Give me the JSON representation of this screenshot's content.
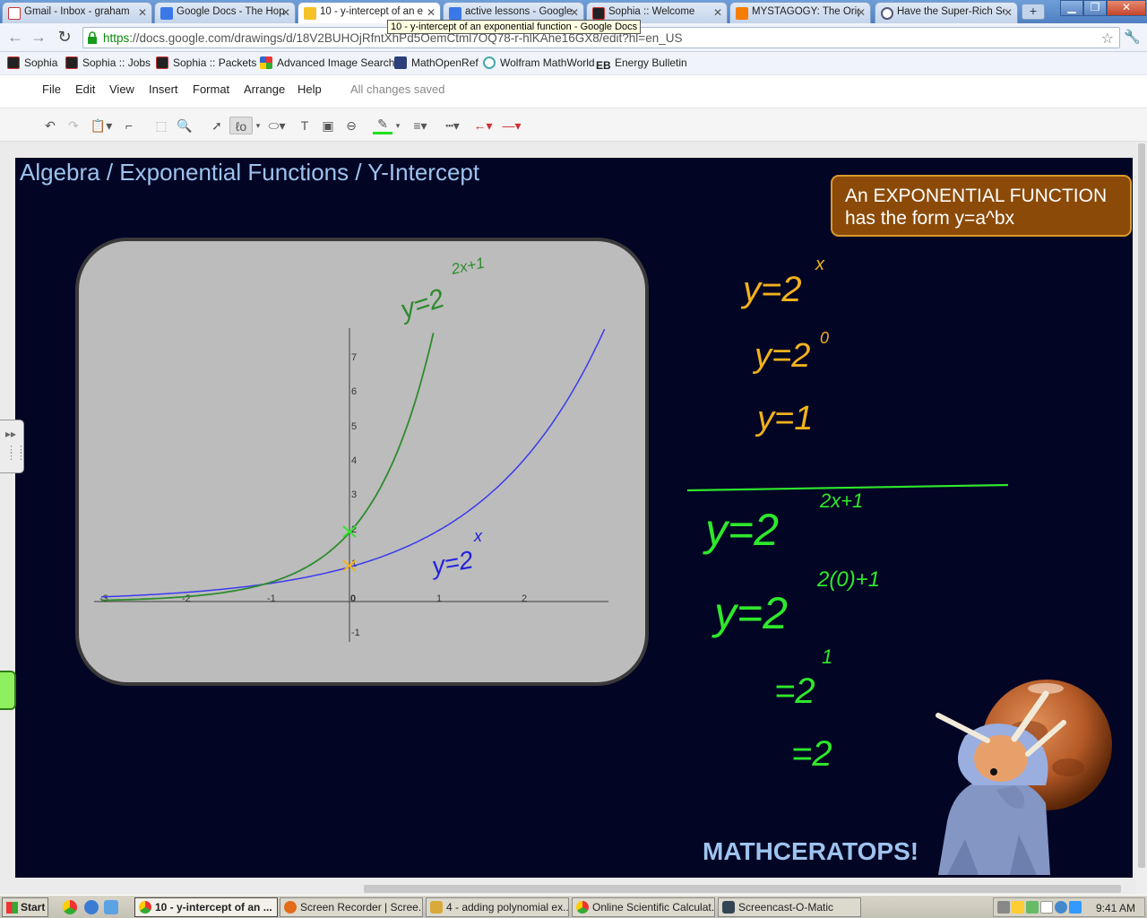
{
  "browser": {
    "tabs": [
      {
        "label": "Gmail - Inbox - graham",
        "icon": "gmail-icon"
      },
      {
        "label": "Google Docs - The Hopp",
        "icon": "google-docs-icon"
      },
      {
        "label": "10 - y-intercept of an e",
        "icon": "google-drawings-icon",
        "active": true
      },
      {
        "label": "active lessons - Google",
        "icon": "google-docs-icon"
      },
      {
        "label": "Sophia :: Welcome",
        "icon": "sophia-icon"
      },
      {
        "label": "MYSTAGOGY: The Origi",
        "icon": "blogger-icon"
      },
      {
        "label": "Have the Super-Rich Se",
        "icon": "globe-icon"
      }
    ],
    "tooltip": "10 - y-intercept of an exponential function - Google Docs",
    "url_scheme": "https",
    "url_rest": "://docs.google.com/drawings/d/18V2BUHOjRfntXhPd5OemCtml7OQ78-r-hlKAhe16GX8/edit?hl=en_US",
    "bookmarks": [
      "Sophia",
      "Sophia :: Jobs",
      "Sophia :: Packets",
      "Advanced Image Search",
      "MathOpenRef",
      "Wolfram MathWorld",
      "Energy Bulletin"
    ]
  },
  "docs": {
    "menus": [
      "File",
      "Edit",
      "View",
      "Insert",
      "Format",
      "Arrange",
      "Help"
    ],
    "save_status": "All changes saved"
  },
  "slide": {
    "title": "Algebra / Exponential Functions / Y-Intercept",
    "callout_line1": "An EXPONENTIAL FUNCTION",
    "callout_line2": "has the form y=a^bx",
    "brand": "MATHCERATOPS!",
    "graph": {
      "x_ticks": [
        "-3",
        "-2",
        "-1",
        "0",
        "1",
        "2"
      ],
      "y_ticks": [
        "7",
        "6",
        "5",
        "4",
        "3",
        "2",
        "1",
        "-1"
      ],
      "curve_label_green": "y=2",
      "curve_exp_green": "2x+1",
      "curve_label_blue": "y=2",
      "curve_exp_blue": "x"
    },
    "handwriting": {
      "work1": [
        "y=2",
        "y=2",
        "y=1"
      ],
      "work1_exps": [
        "x",
        "0"
      ],
      "work2": [
        "y=2",
        "y=2",
        "=2",
        "=2"
      ],
      "work2_exps": [
        "2x+1",
        "2(0)+1",
        "1"
      ]
    },
    "colors": {
      "background": "#020524",
      "title": "#9dc3ee",
      "callout": "#8b4a08",
      "handwriting_yellow": "#f2b21b",
      "handwriting_green": "#2fe82c"
    }
  },
  "taskbar": {
    "start_label": "Start",
    "tasks": [
      {
        "label": "10 - y-intercept of an ...",
        "active": true
      },
      {
        "label": "Screen Recorder | Scree..."
      },
      {
        "label": "4 - adding polynomial ex..."
      },
      {
        "label": "Online Scientific Calculat..."
      },
      {
        "label": "Screencast-O-Matic"
      }
    ],
    "clock": "9:41 AM"
  }
}
